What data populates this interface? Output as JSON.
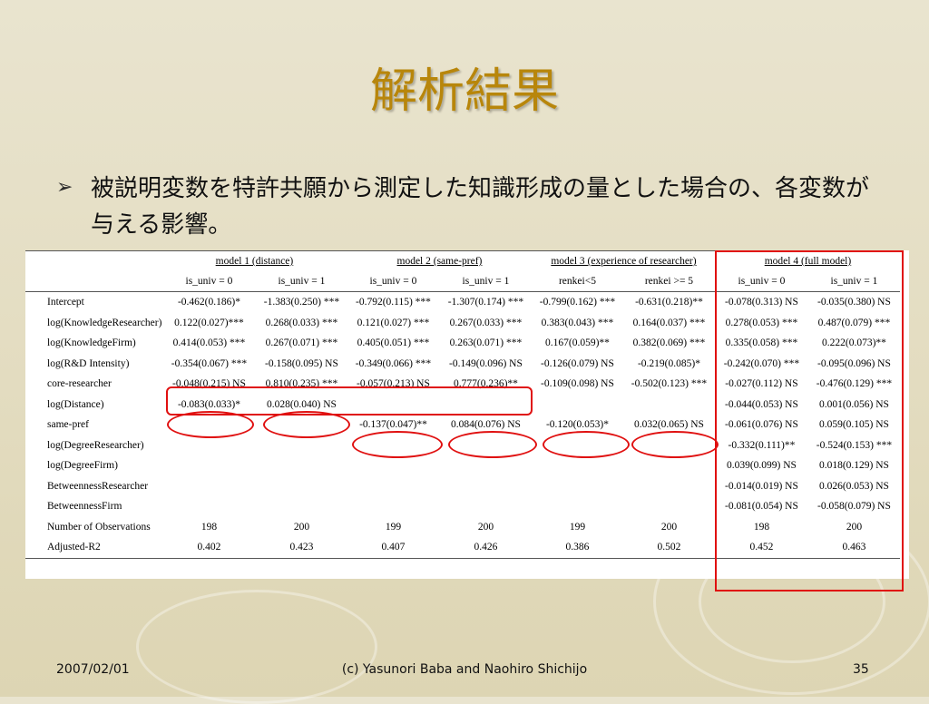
{
  "slide": {
    "title": "解析結果",
    "bullet": "被説明変数を特許共願から測定した知識形成の量とした場合の、各変数が与える影響。"
  },
  "table": {
    "models": [
      "model 1 (distance)",
      "model 2 (same-pref)",
      "model 3 (experience of researcher)",
      "model 4 (full model)"
    ],
    "subheaders": [
      "is_univ = 0",
      "is_univ = 1",
      "is_univ = 0",
      "is_univ = 1",
      "renkei<5",
      "renkei >= 5",
      "is_univ = 0",
      "is_univ = 1"
    ],
    "rows": [
      {
        "label": "Intercept",
        "cells": [
          "-0.462(0.186)*",
          "-1.383(0.250) ***",
          "-0.792(0.115) ***",
          "-1.307(0.174) ***",
          "-0.799(0.162) ***",
          "-0.631(0.218)**",
          "-0.078(0.313) NS",
          "-0.035(0.380) NS"
        ]
      },
      {
        "label": "log(KnowledgeResearcher)",
        "cells": [
          "0.122(0.027)***",
          "0.268(0.033) ***",
          "0.121(0.027) ***",
          "0.267(0.033) ***",
          "0.383(0.043) ***",
          "0.164(0.037) ***",
          "0.278(0.053) ***",
          "0.487(0.079) ***"
        ]
      },
      {
        "label": "log(KnowledgeFirm)",
        "cells": [
          "0.414(0.053) ***",
          "0.267(0.071) ***",
          "0.405(0.051) ***",
          "0.263(0.071) ***",
          "0.167(0.059)**",
          "0.382(0.069) ***",
          "0.335(0.058) ***",
          "0.222(0.073)**"
        ]
      },
      {
        "label": "log(R&D Intensity)",
        "cells": [
          "-0.354(0.067) ***",
          "-0.158(0.095) NS",
          "-0.349(0.066) ***",
          "-0.149(0.096) NS",
          "-0.126(0.079) NS",
          "-0.219(0.085)*",
          "-0.242(0.070) ***",
          "-0.095(0.096) NS"
        ]
      },
      {
        "label": "core-researcher",
        "cells": [
          "-0.048(0.215) NS",
          "0.810(0.235) ***",
          "-0.057(0.213) NS",
          "0.777(0.236)**",
          "-0.109(0.098) NS",
          "-0.502(0.123) ***",
          "-0.027(0.112) NS",
          "-0.476(0.129) ***"
        ]
      },
      {
        "label": "log(Distance)",
        "cells": [
          "-0.083(0.033)*",
          "0.028(0.040) NS",
          "",
          "",
          "",
          "",
          "-0.044(0.053) NS",
          "0.001(0.056) NS"
        ]
      },
      {
        "label": "same-pref",
        "cells": [
          "",
          "",
          "-0.137(0.047)**",
          "0.084(0.076) NS",
          "-0.120(0.053)*",
          "0.032(0.065) NS",
          "-0.061(0.076) NS",
          "0.059(0.105) NS"
        ]
      },
      {
        "label": "log(DegreeResearcher)",
        "cells": [
          "",
          "",
          "",
          "",
          "",
          "",
          "-0.332(0.111)**",
          "-0.524(0.153) ***"
        ]
      },
      {
        "label": "log(DegreeFirm)",
        "cells": [
          "",
          "",
          "",
          "",
          "",
          "",
          "0.039(0.099) NS",
          "0.018(0.129) NS"
        ]
      },
      {
        "label": "BetweennessResearcher",
        "cells": [
          "",
          "",
          "",
          "",
          "",
          "",
          "-0.014(0.019) NS",
          "0.026(0.053) NS"
        ]
      },
      {
        "label": "BetweennessFirm",
        "cells": [
          "",
          "",
          "",
          "",
          "",
          "",
          "-0.081(0.054) NS",
          "-0.058(0.079) NS"
        ]
      },
      {
        "label": "Number of Observations",
        "cells": [
          "198",
          "200",
          "199",
          "200",
          "199",
          "200",
          "198",
          "200"
        ]
      },
      {
        "label": "Adjusted-R2",
        "cells": [
          "0.402",
          "0.423",
          "0.407",
          "0.426",
          "0.386",
          "0.502",
          "0.452",
          "0.463"
        ]
      }
    ]
  },
  "footer": {
    "date": "2007/02/01",
    "copyright": "(c) Yasunori Baba and Naohiro Shichijo",
    "page": "35"
  },
  "colors": {
    "title": "#b8860b",
    "highlight": "#e01010",
    "background": "#e5dfc4"
  }
}
